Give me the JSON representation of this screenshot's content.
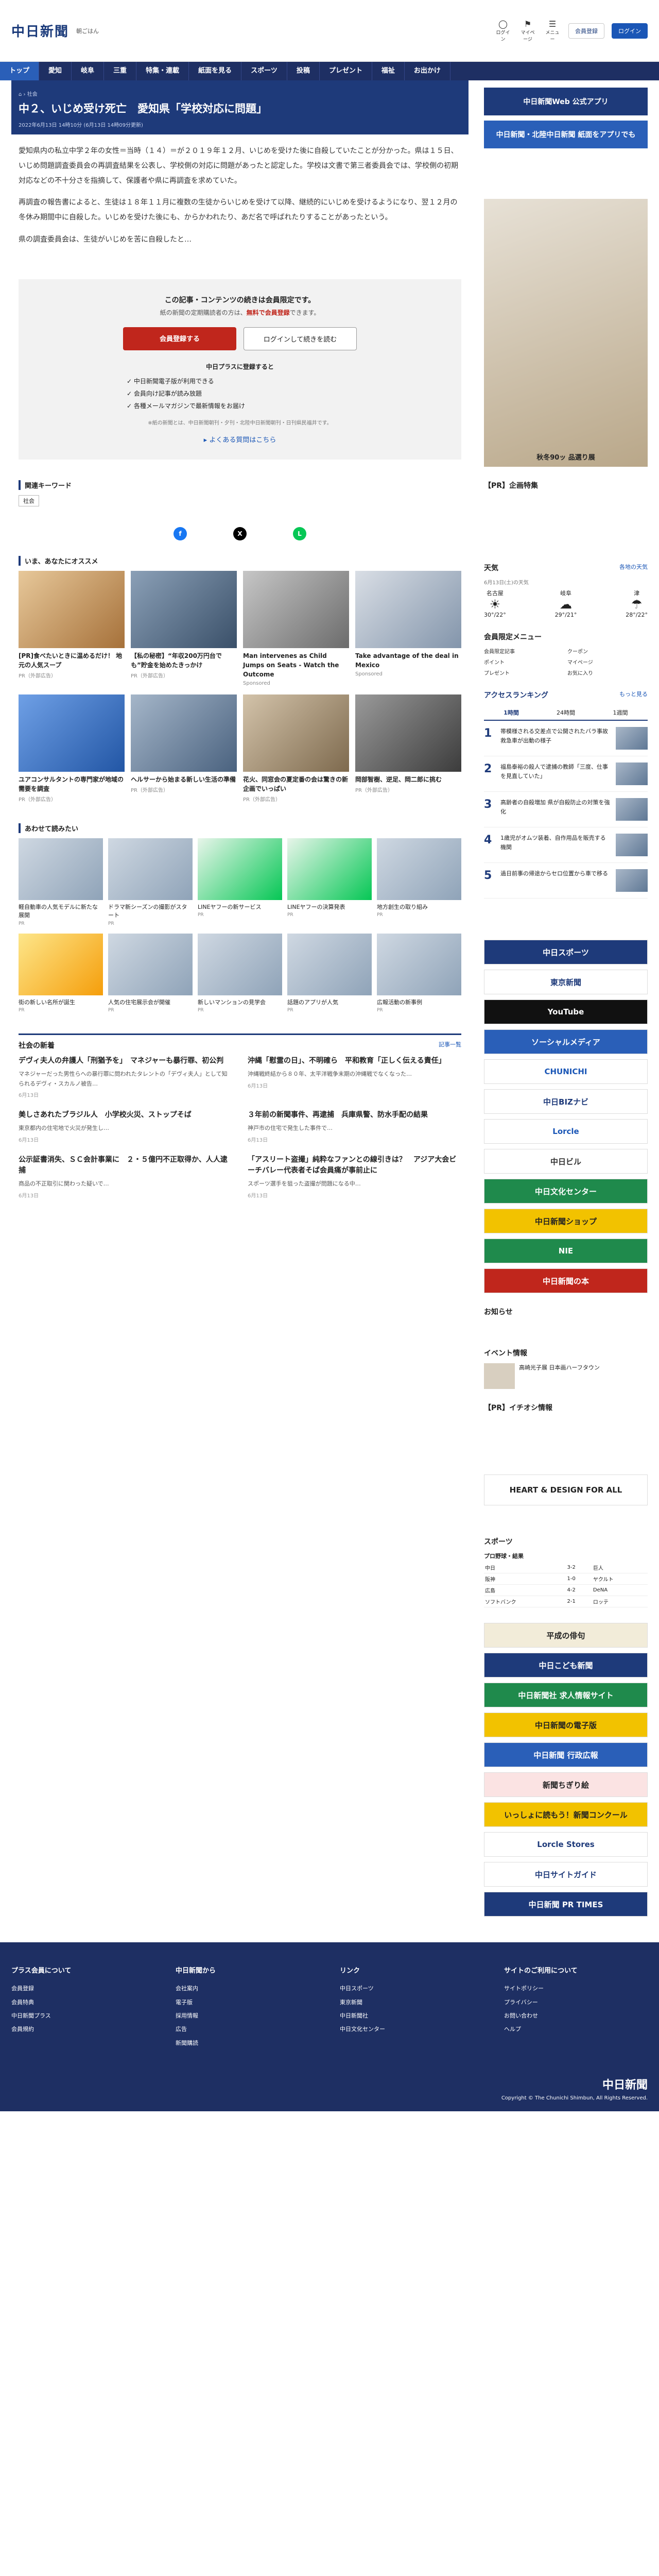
{
  "header": {
    "logo": "中日新聞",
    "login_hint": "朝ごはん",
    "icons": [
      "ログイン",
      "マイページ",
      "メニュー"
    ],
    "btn_register": "会員登録",
    "btn_login": "ログイン"
  },
  "nav": [
    "トップ",
    "愛知",
    "岐阜",
    "三重",
    "特集・連載",
    "紙面を見る",
    "スポーツ",
    "投稿",
    "プレゼント",
    "福祉",
    "お出かけ"
  ],
  "article": {
    "crumb": "社会",
    "title": "中２、いじめ受け死亡　愛知県「学校対応に問題」",
    "date": "2022年6月13日 14時10分 (6月13日 14時09分更新)",
    "paras": [
      "愛知県内の私立中学２年の女性＝当時（１４）＝が２０１９年１２月、いじめを受けた後に自殺していたことが分かった。県は１５日、いじめ問題調査委員会の再調査結果を公表し、学校側の対応に問題があったと認定した。学校は文書で第三者委員会では、学校側の初期対応などの不十分さを指摘して、保護者や県に再調査を求めていた。",
      "再調査の報告書によると、生徒は１８年１１月に複数の生徒からいじめを受けて以降、継続的にいじめを受けるようになり、翌１２月の冬休み期間中に自殺した。いじめを受けた後にも、からかわれたり、あだ名で呼ばれたりすることがあったという。",
      "県の調査委員会は、生徒がいじめを苦に自殺したと…"
    ]
  },
  "paywall": {
    "h": "この記事・コンテンツの続きは会員限定です。",
    "s1": "紙の新聞の定期購読者の方は、",
    "s2": "無料で会員登録",
    "s3": "できます。",
    "btn_register": "会員登録する",
    "btn_login": "ログインして続きを読む",
    "list_h": "中日プラスに登録すると",
    "items": [
      "中日新聞電子版が利用できる",
      "会員向け記事が読み放題",
      "各種メールマガジンで最新情報をお届け"
    ],
    "note": "※紙の新聞とは、中日新聞朝刊・夕刊・北陸中日新聞朝刊・日刊県民福井です。",
    "faq": "よくある質問はこちら"
  },
  "keywords": {
    "h": "関連キーワード",
    "items": [
      "社会"
    ]
  },
  "rec": {
    "h": "いま、あなたにオススメ",
    "items": [
      {
        "t": "[PR]食べたいときに温めるだけ！ 地元の人気スープ",
        "s": "PR（外部広告）"
      },
      {
        "t": "【私の秘密】“年収200万円台でも”貯金を始めたきっかけ",
        "s": "PR（外部広告）"
      },
      {
        "t": "Man intervenes as Child Jumps on Seats - Watch the Outcome",
        "s": "Sponsored"
      },
      {
        "t": "Take advantage of the deal in Mexico",
        "s": "Sponsored"
      },
      {
        "t": "ユアコンサルタントの専門家が地域の需要を調査",
        "s": "PR（外部広告）"
      },
      {
        "t": "ヘルサーから始まる新しい生活の準備",
        "s": "PR（外部広告）"
      },
      {
        "t": "花火、同窓会の夏定番の会は驚きの新企画でいっぱい",
        "s": "PR（外部広告）"
      },
      {
        "t": "岡部智樹、逆足、岡二郎に挑む",
        "s": "PR（外部広告）"
      }
    ]
  },
  "adsec": {
    "h": "あわせて読みたい",
    "items": [
      {
        "t": "軽自動車の人気モデルに新たな展開",
        "s": "PR"
      },
      {
        "t": "ドラマ新シーズンの撮影がスタート",
        "s": "PR"
      },
      {
        "t": "LINEヤフーの新サービス",
        "s": "PR"
      },
      {
        "t": "LINEヤフーの決算発表",
        "s": "PR"
      },
      {
        "t": "地方創生の取り組み",
        "s": "PR"
      },
      {
        "t": "街の新しい名所が誕生",
        "s": "PR"
      },
      {
        "t": "人気の住宅展示会が開催",
        "s": "PR"
      },
      {
        "t": "新しいマンションの見学会",
        "s": "PR"
      },
      {
        "t": "話題のアプリが人気",
        "s": "PR"
      },
      {
        "t": "広報活動の新事例",
        "s": "PR"
      }
    ]
  },
  "social": {
    "h": "社会の新着",
    "more": "記事一覧",
    "items": [
      {
        "h": "デヴィ夫人の弁護人「刑猶予を」　マネジャーも暴行罪、初公判",
        "p": "マネジャーだった男性らへの暴行罪に問われたタレントの「デヴィ夫人」として知られるデヴィ・スカルノ被告…",
        "d": "6月13日"
      },
      {
        "h": "沖縄「慰霊の日」、不明確ら　平和教育「正しく伝える責任」",
        "p": "沖縄戦終結から８０年、太平洋戦争末期の沖縄戦でなくなった…",
        "d": "6月13日"
      },
      {
        "h": "美しさあれたブラジル人　小学校火災、ストップそば",
        "p": "東京都内の住宅地で火災が発生し…",
        "d": "6月13日"
      },
      {
        "h": "３年前の新聞事件、再逮捕　兵庫県警、防水手配の結果",
        "p": "神戸市の住宅で発生した事件で…",
        "d": "6月13日"
      },
      {
        "h": "公示証書消失、ＳＣ会計事業に　２・５億円不正取得か、人人逮捕",
        "p": "商品の不正取引に関わった疑いで…",
        "d": "6月13日"
      },
      {
        "h": "「アスリート盗撮」純粋なファンとの線引きは？　アジア大会ビーチバレー代表者そば会員痛が事前止に",
        "p": "スポーツ選手を狙った盗撮が問題になる中…",
        "d": "6月13日"
      }
    ]
  },
  "side": {
    "ad1": "中日新聞Web 公式アプリ",
    "ad2": "中日新聞・北陸中日新聞 紙面をアプリでも",
    "promo": "秋冬90ッ 品選り展",
    "pr": "【PR】企画特集",
    "weather": {
      "h": "天気",
      "more": "各地の天気",
      "date": "6月13日(土)の天気",
      "cities": [
        {
          "n": "名古屋",
          "i": "☀",
          "t": "30°/22°"
        },
        {
          "n": "岐阜",
          "i": "☁",
          "t": "29°/21°"
        },
        {
          "n": "津",
          "i": "☂",
          "t": "28°/22°"
        }
      ]
    },
    "member": {
      "h": "会員限定メニュー",
      "links": [
        "会員限定記事",
        "クーポン",
        "ポイント",
        "マイページ",
        "プレゼント",
        "お気に入り"
      ]
    },
    "rank": {
      "h": "アクセスランキング",
      "more": "もっと見る",
      "tabs": [
        "1時間",
        "24時間",
        "1週間"
      ],
      "items": [
        {
          "n": "1",
          "t": "帯模様される交差点で公開されたバラ事故 救急車が出動の様子"
        },
        {
          "n": "2",
          "t": "福島泰裕の殺人で逮捕の教師「三度、仕事を見直していた」"
        },
        {
          "n": "3",
          "t": "高齢者の自殺増加 県が自殺防止の対策を強化"
        },
        {
          "n": "4",
          "t": "1歳児がオムツ装着、自作用品を販売する機関"
        },
        {
          "n": "5",
          "t": "過日前事の帰途からセロ位置から車で移る"
        }
      ]
    },
    "banners": [
      "中日スポーツ",
      "東京新聞",
      "YouTube",
      "ソーシャルメディア",
      "CHUNICHI",
      "中日BIZナビ",
      "Lorcle",
      "中日ビル",
      "中日文化センター",
      "中日新聞ショップ",
      "NIE",
      "中日新聞の本"
    ],
    "notice": "お知らせ",
    "event": "イベント情報",
    "event_item": "高崎光子展 日本画ハーフタウン",
    "pr2": "【PR】イチオシ情報",
    "heart": "HEART & DESIGN FOR ALL",
    "sports": {
      "h": "スポーツ",
      "table_h": "プロ野球・結果",
      "rows": [
        [
          "中日",
          "3-2",
          "巨人"
        ],
        [
          "阪神",
          "1-0",
          "ヤクルト"
        ],
        [
          "広島",
          "4-2",
          "DeNA"
        ],
        [
          "ソフトバンク",
          "2-1",
          "ロッテ"
        ]
      ]
    },
    "banners2": [
      "平成の俳句",
      "中日こども新聞",
      "中日新聞社 求人情報サイト",
      "中日新聞の電子版",
      "中日新聞 行政広報",
      "新聞ちぎり絵",
      "いっしょに読もう！新聞コンクール",
      "Lorcle Stores",
      "中日サイトガイド",
      "中日新聞 PR TIMES"
    ]
  },
  "footer": {
    "cols": [
      {
        "h": "プラス会員について",
        "items": [
          "会員登録",
          "会員特典",
          "中日新聞プラス",
          "会員規約"
        ]
      },
      {
        "h": "中日新聞から",
        "items": [
          "会社案内",
          "電子版",
          "採用情報",
          "広告",
          "新聞購読"
        ]
      },
      {
        "h": "リンク",
        "items": [
          "中日スポーツ",
          "東京新聞",
          "中日新聞社",
          "中日文化センター"
        ]
      },
      {
        "h": "サイトのご利用について",
        "items": [
          "サイトポリシー",
          "プライバシー",
          "お問い合わせ",
          "ヘルプ"
        ]
      }
    ],
    "logo": "中日新聞",
    "copy": "Copyright © The Chunichi Shimbun, All Rights Reserved."
  }
}
